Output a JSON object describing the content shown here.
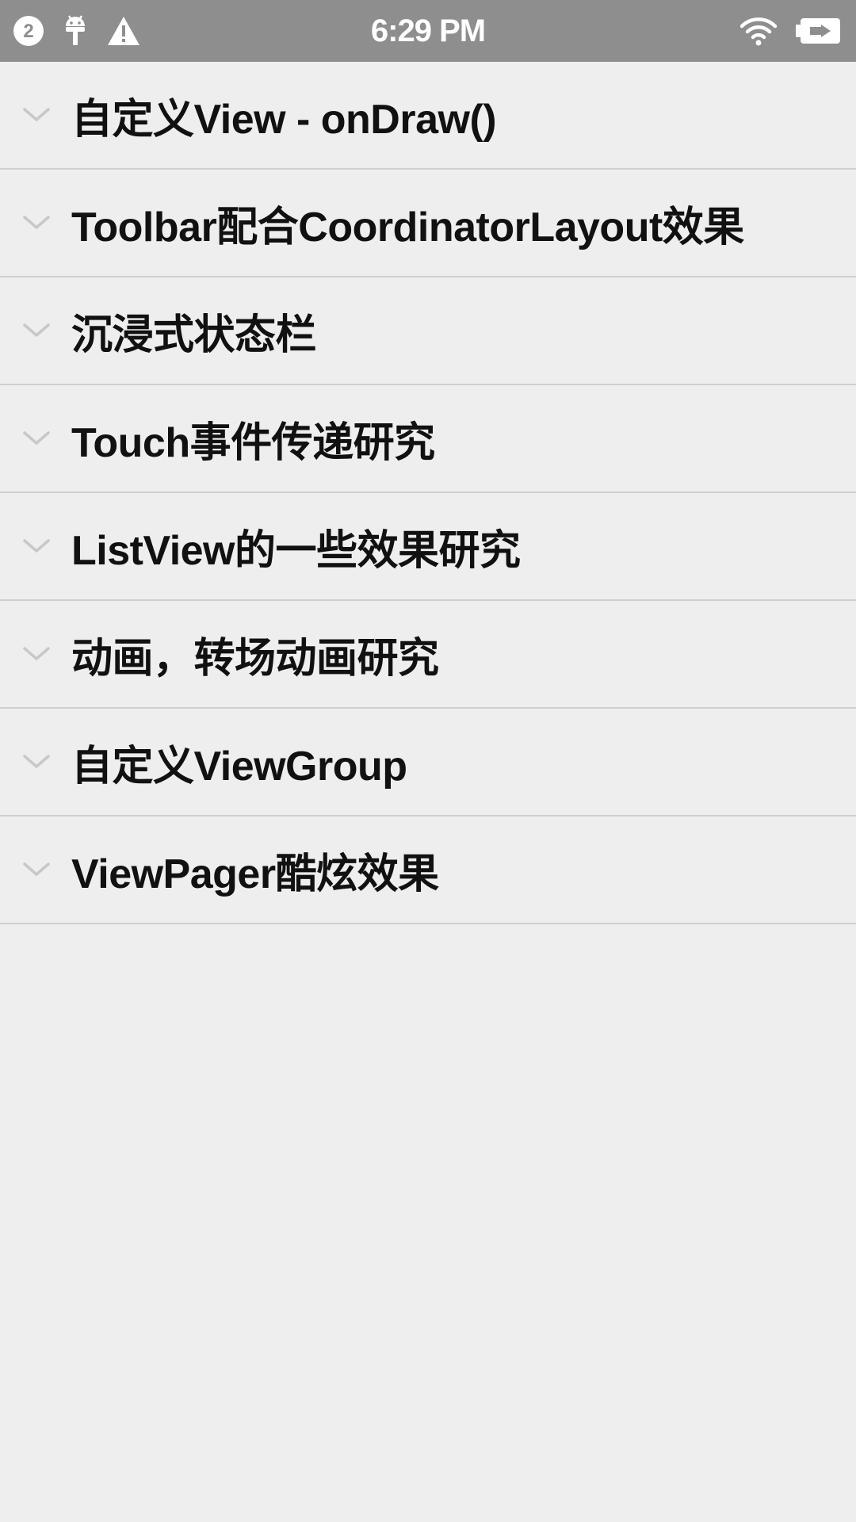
{
  "status_bar": {
    "notification_count": "2",
    "time": "6:29 PM",
    "icons": [
      "notification-count-icon",
      "android-debug-icon",
      "warning-icon",
      "wifi-icon",
      "battery-charging-icon"
    ],
    "background": "#8e8e8e"
  },
  "list": {
    "items": [
      {
        "label": "自定义View - onDraw()"
      },
      {
        "label": "Toolbar配合CoordinatorLayout效果"
      },
      {
        "label": "沉浸式状态栏"
      },
      {
        "label": "Touch事件传递研究"
      },
      {
        "label": "ListView的一些效果研究"
      },
      {
        "label": "动画，转场动画研究"
      },
      {
        "label": "自定义ViewGroup"
      },
      {
        "label": "ViewPager酷炫效果"
      }
    ],
    "chevron_icon": "chevron-down-icon",
    "chevron_color": "#c8c8c8"
  }
}
